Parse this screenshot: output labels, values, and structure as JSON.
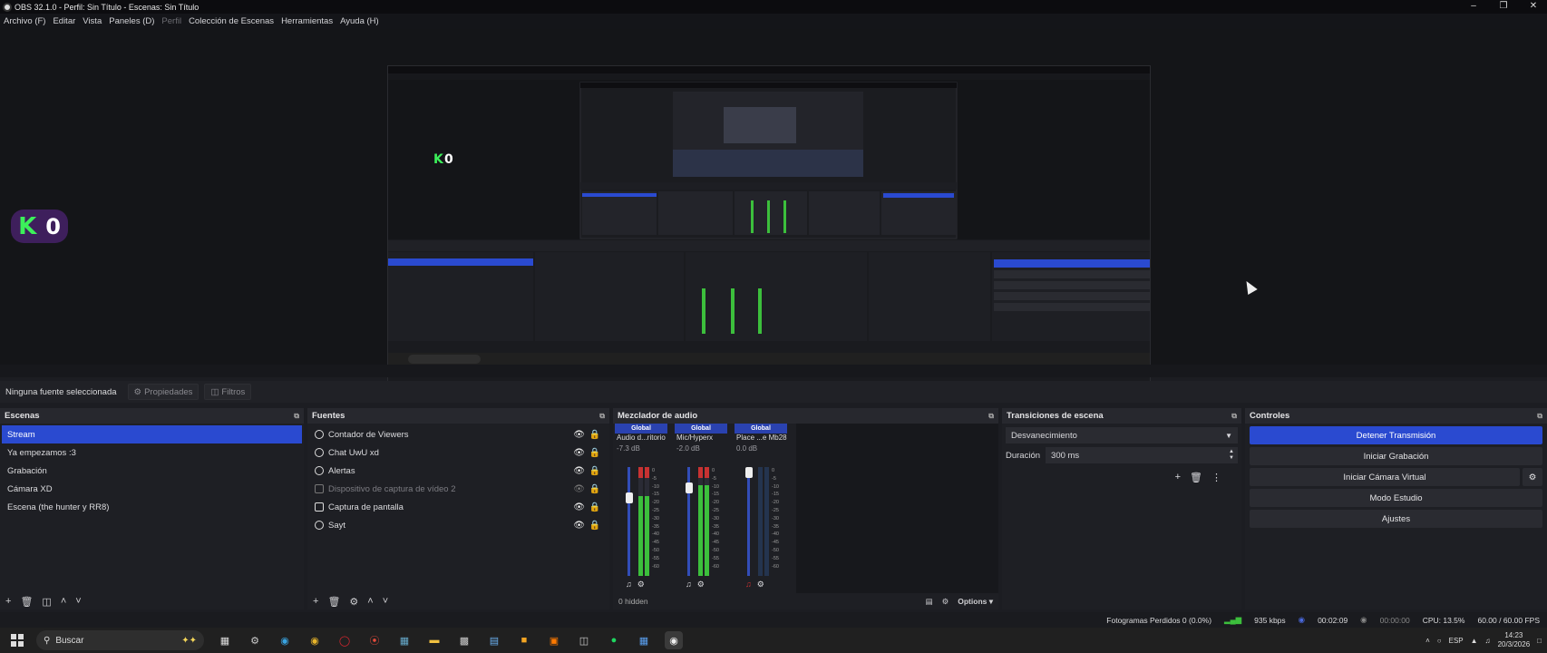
{
  "window": {
    "title": "OBS 32.1.0 - Perfil: Sin Título - Escenas: Sin Título",
    "minimize_icon": "minimize-icon",
    "maximize_icon": "maximize-icon",
    "close_icon": "close-icon"
  },
  "menu": [
    "Archivo (F)",
    "Editar",
    "Vista",
    "Paneles (D)",
    "Perfil",
    "Colección de Escenas",
    "Herramientas",
    "Ayuda (H)"
  ],
  "preview": {
    "badge_k": "K",
    "badge_n": "0"
  },
  "source_toolbar": {
    "no_source_selected": "Ninguna fuente seleccionada",
    "properties_label": "Propiedades",
    "filters_label": "Filtros"
  },
  "scenes": {
    "header": "Escenas",
    "items": [
      "Stream",
      "Ya empezamos :3",
      "Grabación",
      "Cámara XD",
      "Escena (the hunter y RR8)"
    ],
    "selected_index": 0
  },
  "sources": {
    "header": "Fuentes",
    "items": [
      {
        "label": "Contador de Viewers",
        "icon": "globe-icon",
        "hidden": false
      },
      {
        "label": "Chat UwU xd",
        "icon": "globe-icon",
        "hidden": false
      },
      {
        "label": "Alertas",
        "icon": "globe-icon",
        "hidden": false
      },
      {
        "label": "Dispositivo de captura de vídeo 2",
        "icon": "camera-icon",
        "hidden": true
      },
      {
        "label": "Captura de pantalla",
        "icon": "monitor-icon",
        "hidden": false
      },
      {
        "label": "Sayt",
        "icon": "globe-icon",
        "hidden": false
      }
    ]
  },
  "mixer": {
    "header": "Mezclador de audio",
    "channels": [
      {
        "global": "Global",
        "name": "Audio d...ritorio",
        "db": "-7.3 dB",
        "volume": 0.75
      },
      {
        "global": "Global",
        "name": "Mic/Hyperx",
        "db": "-2.0 dB",
        "volume": 0.85
      },
      {
        "global": "Global",
        "name": "Place ...e Mb28",
        "db": "0.0 dB",
        "volume": 1.0
      }
    ],
    "scale": [
      "0",
      "-5",
      "-10",
      "-15",
      "-20",
      "-25",
      "-30",
      "-35",
      "-40",
      "-45",
      "-50",
      "-55",
      "-60"
    ],
    "hidden_count": "0 hidden",
    "options_label": "Options"
  },
  "transitions": {
    "header": "Transiciones de escena",
    "selected": "Desvanecimiento",
    "duration_label": "Duración",
    "duration_value": "300 ms"
  },
  "controls": {
    "header": "Controles",
    "stop_stream": "Detener Transmisión",
    "start_recording": "Iniciar Grabación",
    "start_virtual_cam": "Iniciar Cámara Virtual",
    "studio_mode": "Modo Estudio",
    "settings": "Ajustes"
  },
  "status": {
    "dropped_frames": "Fotogramas Perdidos 0 (0.0%)",
    "bitrate": "935 kbps",
    "stream_time": "00:02:09",
    "rec_time": "00:00:00",
    "cpu": "CPU: 13.5%",
    "fps": "60.00 / 60.00 FPS"
  },
  "taskbar": {
    "search_placeholder": "Buscar",
    "lang": "ESP",
    "time": "14:23",
    "date": "20/3/2026"
  },
  "colors": {
    "accent": "#2a4ad0",
    "meter_green": "#3cbf3c",
    "meter_red": "#c83232"
  }
}
